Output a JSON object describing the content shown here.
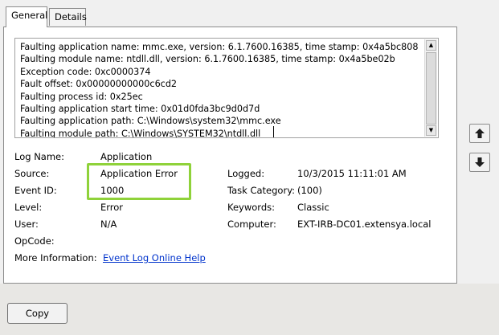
{
  "tabs": [
    {
      "label": "General",
      "active": true
    },
    {
      "label": "Details",
      "active": false
    }
  ],
  "description_lines": [
    "Faulting application name: mmc.exe, version: 6.1.7600.16385, time stamp: 0x4a5bc808",
    "Faulting module name: ntdll.dll, version: 6.1.7600.16385, time stamp: 0x4a5be02b",
    "Exception code: 0xc0000374",
    "Fault offset: 0x00000000000c6cd2",
    "Faulting process id: 0x25ec",
    "Faulting application start time: 0x01d0fda3bc9d0d7d",
    "Faulting application path: C:\\Windows\\system32\\mmc.exe",
    "Faulting module path: C:\\Windows\\SYSTEM32\\ntdll.dll"
  ],
  "fields": {
    "log_name": {
      "label": "Log Name:",
      "value": "Application"
    },
    "source": {
      "label": "Source:",
      "value": "Application Error"
    },
    "event_id": {
      "label": "Event ID:",
      "value": "1000"
    },
    "level": {
      "label": "Level:",
      "value": "Error"
    },
    "user": {
      "label": "User:",
      "value": "N/A"
    },
    "opcode": {
      "label": "OpCode:",
      "value": ""
    },
    "more_info": {
      "label": "More Information:",
      "link": "Event Log Online Help"
    },
    "logged": {
      "label": "Logged:",
      "value": "10/3/2015 11:11:01 AM"
    },
    "task_category": {
      "label": "Task Category:",
      "value": "(100)"
    },
    "keywords": {
      "label": "Keywords:",
      "value": "Classic"
    },
    "computer": {
      "label": "Computer:",
      "value": "EXT-IRB-DC01.extensya.local"
    }
  },
  "buttons": {
    "copy": "Copy",
    "nav_up_icon": "arrow-up-icon",
    "nav_down_icon": "arrow-down-icon"
  },
  "colors": {
    "highlight": "#8fd23a",
    "link": "#0033cc"
  }
}
